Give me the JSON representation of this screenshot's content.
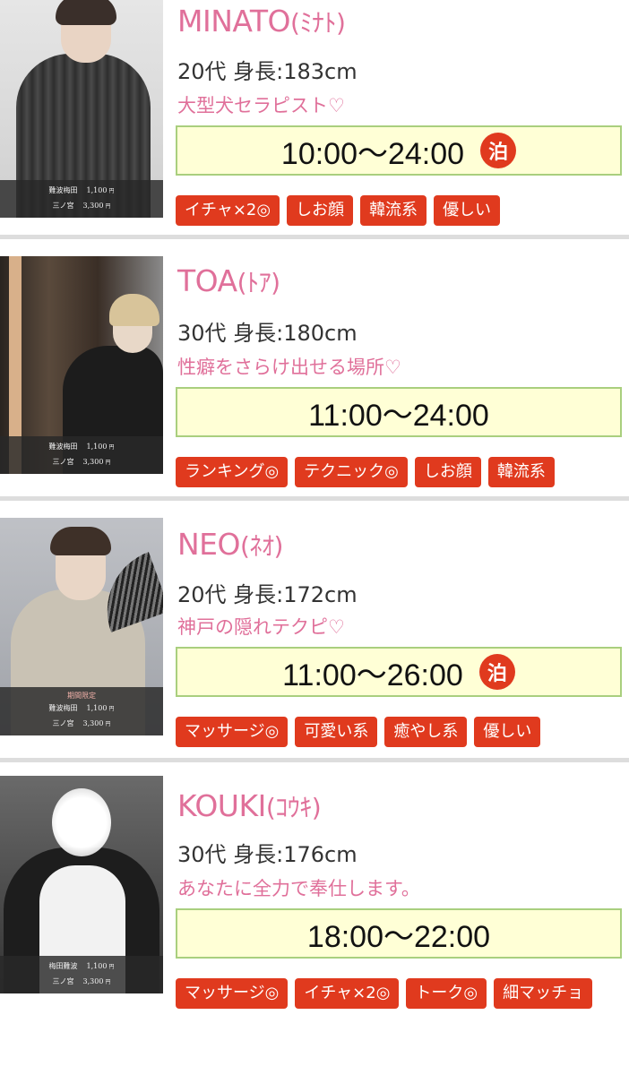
{
  "casts": [
    {
      "name": "MINATO",
      "kana": "(ﾐﾅﾄ)",
      "stats": "20代 身長:183cm",
      "catch": "大型犬セラピスト♡",
      "hours": "10:00〜24:00",
      "overnight_badge": "泊",
      "tags": [
        "イチャ×2◎",
        "しお顔",
        "韓流系",
        "優しい"
      ],
      "photo": {
        "prices": [
          {
            "area": "難波梅田",
            "price": "1,100",
            "unit": "円"
          },
          {
            "area": "三ノ宮",
            "price": "3,300",
            "unit": "円"
          }
        ]
      }
    },
    {
      "name": "TOA",
      "kana": "(ﾄｱ)",
      "stats": "30代 身長:180cm",
      "catch": "性癖をさらけ出せる場所♡",
      "hours": "11:00〜24:00",
      "tags": [
        "ランキング◎",
        "テクニック◎",
        "しお顔",
        "韓流系"
      ],
      "photo": {
        "prices": [
          {
            "area": "難波梅田",
            "price": "1,100",
            "unit": "円"
          },
          {
            "area": "三ノ宮",
            "price": "3,300",
            "unit": "円"
          }
        ]
      }
    },
    {
      "name": "NEO",
      "kana": "(ﾈｵ)",
      "stats": "20代 身長:172cm",
      "catch": "神戸の隠れテクピ♡",
      "hours": "11:00〜26:00",
      "overnight_badge": "泊",
      "tags": [
        "マッサージ◎",
        "可愛い系",
        "癒やし系",
        "優しい"
      ],
      "photo": {
        "note": "期間限定",
        "prices": [
          {
            "area": "難波梅田",
            "price": "1,100",
            "unit": "円"
          },
          {
            "area": "三ノ宮",
            "price": "3,300",
            "unit": "円"
          }
        ]
      }
    },
    {
      "name": "KOUKI",
      "kana": "(ｺｳｷ)",
      "stats": "30代 身長:176cm",
      "catch": "あなたに全力で奉仕します。",
      "hours": "18:00〜22:00",
      "tags": [
        "マッサージ◎",
        "イチャ×2◎",
        "トーク◎",
        "細マッチョ"
      ],
      "photo": {
        "prices": [
          {
            "area": "梅田難波",
            "price": "1,100",
            "unit": "円"
          },
          {
            "area": "三ノ宮",
            "price": "3,300",
            "unit": "円"
          }
        ]
      }
    }
  ],
  "colors": {
    "name": "#e0709a",
    "tag_bg": "#e03a1e",
    "hours_bg": "#ffffd6",
    "hours_border": "#a9cf7e"
  }
}
